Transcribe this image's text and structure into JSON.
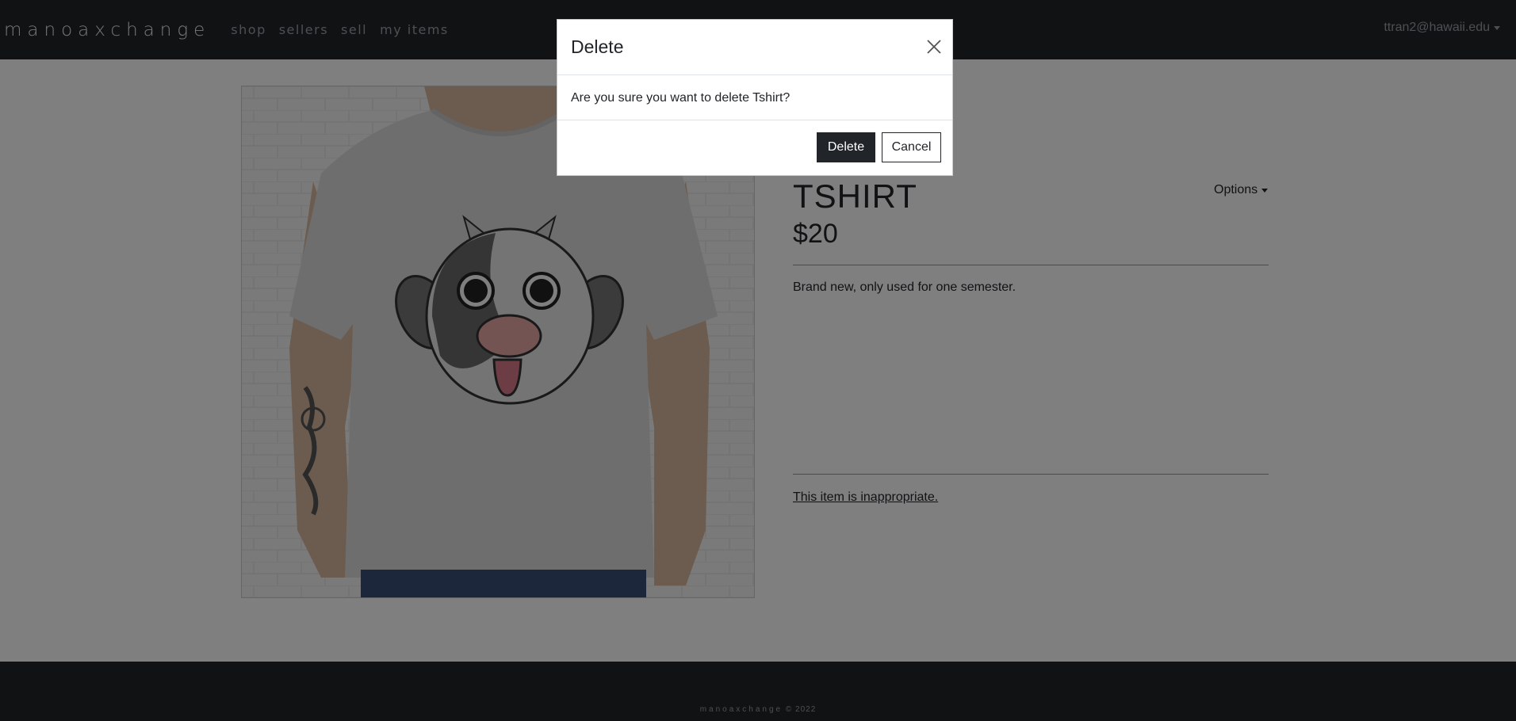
{
  "navbar": {
    "brand": "manoaxchange",
    "links": [
      {
        "label": "shop"
      },
      {
        "label": "sellers"
      },
      {
        "label": "sell"
      },
      {
        "label": "my items"
      }
    ],
    "user": "ttran2@hawaii.edu"
  },
  "item": {
    "title": "TSHIRT",
    "price": "$20",
    "description": "Brand new, only used for one semester.",
    "options_label": "Options",
    "report_label": "This item is inappropriate.",
    "image_icon": "cow-tshirt-image"
  },
  "footer": {
    "brand": "manoaxchange",
    "copyright": " © 2022"
  },
  "modal": {
    "title": "Delete",
    "message": "Are you sure you want to delete Tshirt?",
    "delete_label": "Delete",
    "cancel_label": "Cancel",
    "close_icon": "close-icon"
  },
  "colors": {
    "navbar_bg": "#212529",
    "backdrop": "rgba(0,0,0,0.5)",
    "button_dark": "#212529"
  }
}
